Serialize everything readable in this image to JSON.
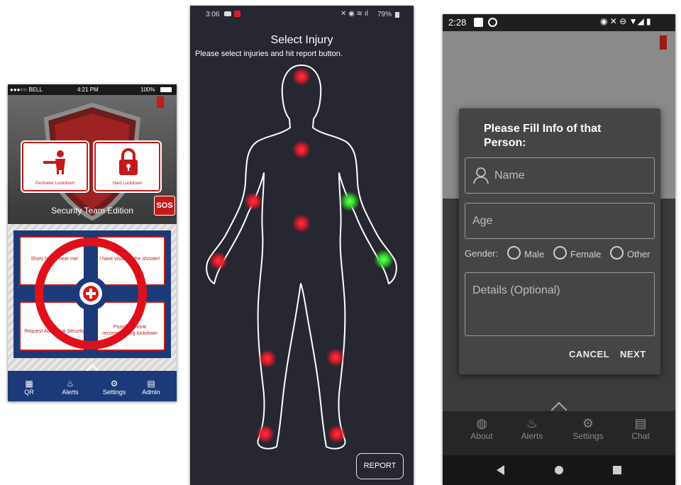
{
  "phone1": {
    "status": {
      "carrier": "●●●○○ BELL",
      "time": "4:21 PM",
      "battery": "100%"
    },
    "cards": [
      "Perimeter Lookdown",
      "Hard Lockdown"
    ],
    "edition": "Security Team Edition",
    "sos": "SOS",
    "cells": [
      "Shots heard near me!",
      "I have visual of the shooter!",
      "Request Additional Security",
      "Possible threat recommending lockdown"
    ],
    "nav": [
      {
        "icon": "qr-icon",
        "label": "QR"
      },
      {
        "icon": "alerts-icon",
        "label": "Alerts"
      },
      {
        "icon": "settings-icon",
        "label": "Settings"
      },
      {
        "icon": "admin-icon",
        "label": "Admin"
      }
    ],
    "colors": {
      "brand_red": "#c41a1a",
      "brand_blue": "#1c3a7a"
    }
  },
  "phone2": {
    "status": {
      "time": "3:06",
      "battery": "79%"
    },
    "title": "Select Injury",
    "subtitle": "Please select injuries and hit report button.",
    "report_label": "REPORT",
    "injury_points": [
      {
        "name": "head",
        "state": "unselected"
      },
      {
        "name": "chest",
        "state": "unselected"
      },
      {
        "name": "abdomen",
        "state": "unselected"
      },
      {
        "name": "right-upper-arm",
        "state": "unselected"
      },
      {
        "name": "left-upper-arm",
        "state": "selected"
      },
      {
        "name": "right-hand",
        "state": "unselected"
      },
      {
        "name": "left-hand",
        "state": "selected"
      },
      {
        "name": "right-knee",
        "state": "unselected"
      },
      {
        "name": "left-knee",
        "state": "unselected"
      },
      {
        "name": "right-foot",
        "state": "unselected"
      },
      {
        "name": "left-foot",
        "state": "unselected"
      }
    ],
    "colors": {
      "unselected": "#e0192a",
      "selected": "#2bd62b"
    }
  },
  "phone3": {
    "status": {
      "time": "2:28"
    },
    "dialog": {
      "title": "Please Fill Info of that Person:",
      "name_placeholder": "Name",
      "age_placeholder": "Age",
      "gender_label": "Gender:",
      "gender_options": [
        "Male",
        "Female",
        "Other"
      ],
      "details_placeholder": "Details (Optional)",
      "cancel_label": "CANCEL",
      "next_label": "NEXT"
    },
    "nav": [
      {
        "icon": "globe-icon",
        "label": "About"
      },
      {
        "icon": "alerts-icon",
        "label": "Alerts"
      },
      {
        "icon": "settings-icon",
        "label": "Settings"
      },
      {
        "icon": "chat-icon",
        "label": "Chat"
      }
    ]
  }
}
